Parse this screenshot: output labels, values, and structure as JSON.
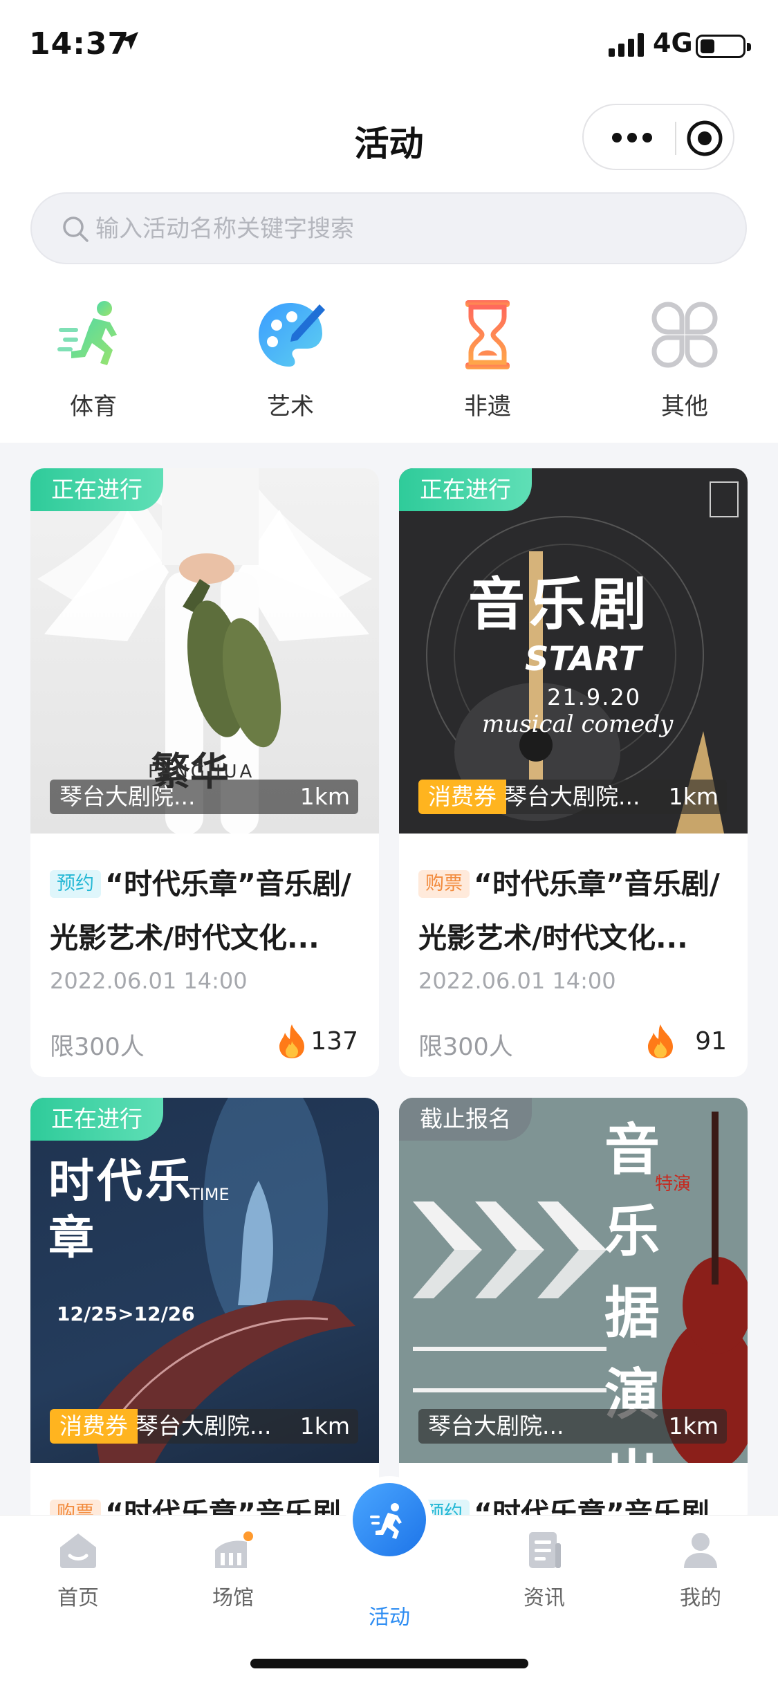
{
  "status_bar": {
    "time": "14:37",
    "network": "4G"
  },
  "header": {
    "title": "活动"
  },
  "search": {
    "placeholder": "输入活动名称关键字搜索"
  },
  "categories": [
    {
      "label": "体育",
      "icon": "runner-icon"
    },
    {
      "label": "艺术",
      "icon": "palette-icon"
    },
    {
      "label": "非遗",
      "icon": "hourglass-icon"
    },
    {
      "label": "其他",
      "icon": "clover-icon"
    }
  ],
  "cards": [
    {
      "status": "正在进行",
      "poster_text": "FANGHUA",
      "coupon": "",
      "venue": "琴台大剧院...",
      "distance": "1km",
      "badge": "预约",
      "title": "“时代乐章”音乐剧/光影艺术/时代文化...",
      "date": "2022.06.01 14:00",
      "limit": "限300人",
      "hot": "137"
    },
    {
      "status": "正在进行",
      "poster_text": "音乐剧",
      "poster_sub": "START",
      "poster_date": "21.9.20",
      "poster_en": "musical comedy",
      "coupon": "消费券",
      "venue": "琴台大剧院...",
      "distance": "1km",
      "badge": "购票",
      "title": "“时代乐章”音乐剧/光影艺术/时代文化...",
      "date": "2022.06.01 14:00",
      "limit": "限300人",
      "hot": "91"
    },
    {
      "status": "正在进行",
      "poster_text": "时代乐章",
      "poster_sub": "TIME",
      "poster_date": "12/25>12/26",
      "coupon": "消费券",
      "venue": "琴台大剧院...",
      "distance": "1km",
      "badge": "购票",
      "title": "“时代乐章”音乐剧"
    },
    {
      "status": "截止报名",
      "poster_text": "音乐据演出",
      "poster_sub": "特演",
      "coupon": "",
      "venue": "琴台大剧院...",
      "distance": "1km",
      "badge": "预约",
      "title": "“时代乐章”音乐剧"
    }
  ],
  "tabbar": [
    {
      "label": "首页",
      "icon": "home-icon"
    },
    {
      "label": "场馆",
      "icon": "stadium-icon"
    },
    {
      "label": "活动",
      "icon": "activity-icon",
      "active": true
    },
    {
      "label": "资讯",
      "icon": "news-icon"
    },
    {
      "label": "我的",
      "icon": "user-icon"
    }
  ],
  "colors": {
    "accent": "#2c8cf2",
    "tag_green": "#2fcb9a",
    "coupon": "#ffb41f"
  }
}
